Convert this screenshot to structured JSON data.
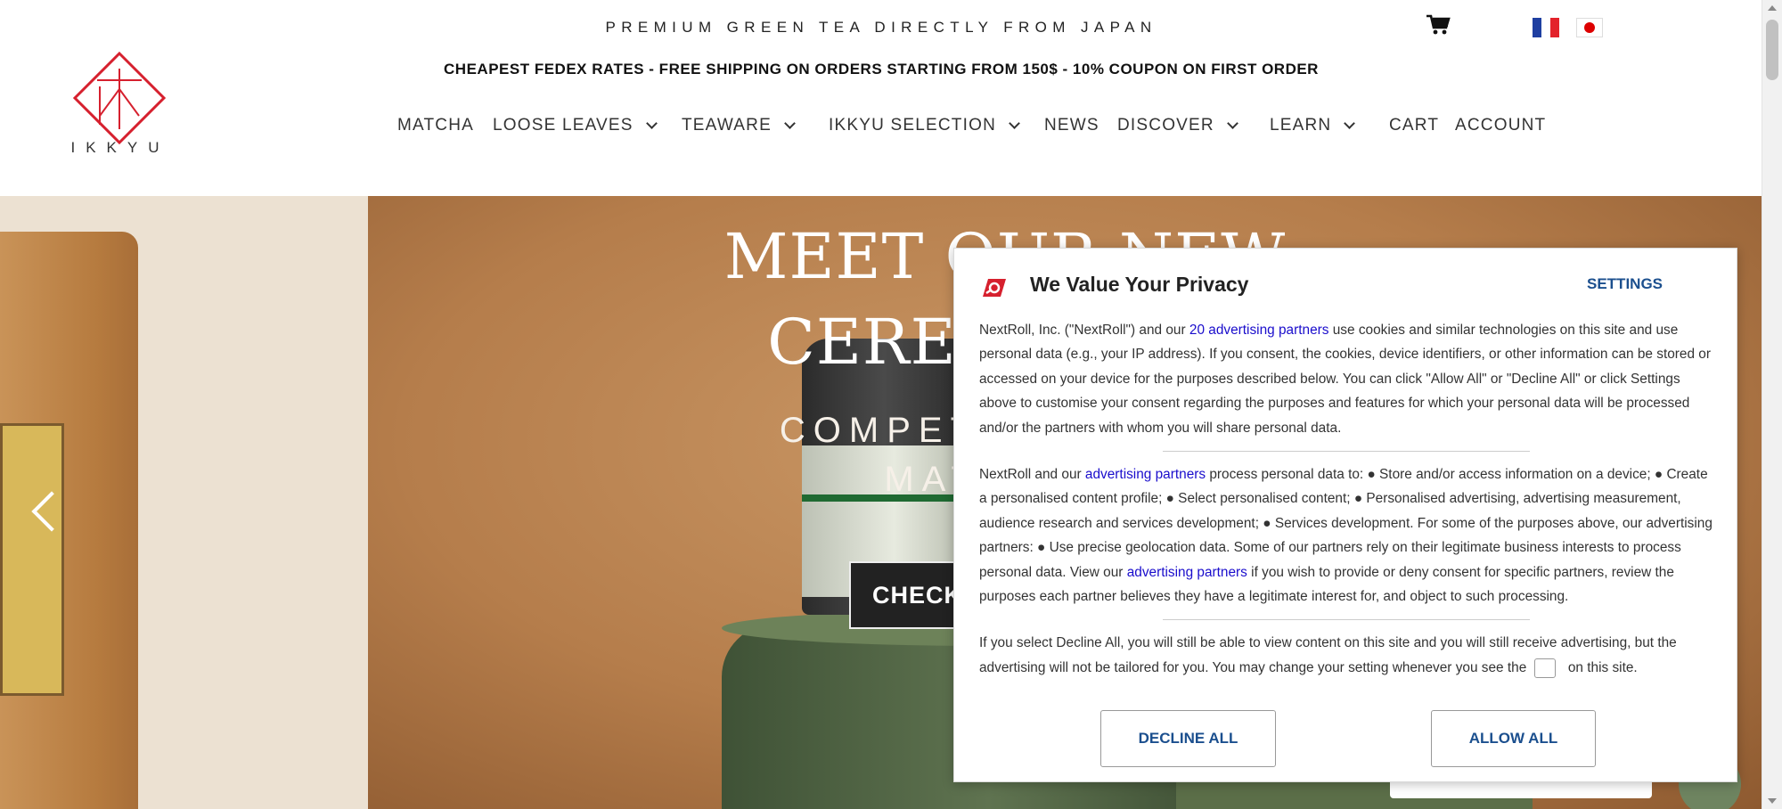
{
  "header": {
    "announcement": "PREMIUM GREEN TEA DIRECTLY FROM JAPAN",
    "promo": "CHEAPEST FEDEX RATES - FREE SHIPPING ON ORDERS STARTING FROM 150$ - 10% COUPON ON FIRST ORDER",
    "logo_text": "IKKYU",
    "cart_icon": "shopping-cart-icon",
    "flags": [
      "france-flag-icon",
      "japan-flag-icon"
    ]
  },
  "nav": {
    "items": [
      {
        "label": "MATCHA",
        "dropdown": false
      },
      {
        "label": "LOOSE LEAVES",
        "dropdown": true
      },
      {
        "label": "TEAWARE",
        "dropdown": true
      },
      {
        "label": "IKKYU SELECTION",
        "dropdown": true
      },
      {
        "label": "NEWS",
        "dropdown": false
      },
      {
        "label": "DISCOVER",
        "dropdown": true
      },
      {
        "label": "LEARN",
        "dropdown": true
      },
      {
        "label": "CART",
        "dropdown": false
      },
      {
        "label": "ACCOUNT",
        "dropdown": false
      }
    ]
  },
  "hero": {
    "title_line1": "MEET OUR NEW",
    "title_line2": "CEREMONIAL",
    "subtitle_line1": "COMPETITION AND",
    "subtitle_line2": "MATCHA F",
    "cta": "CHECK",
    "prev_icon": "chevron-left-icon"
  },
  "consent": {
    "title": "We Value Your Privacy",
    "settings_label": "SETTINGS",
    "p1_a": "NextRoll, Inc. (\"NextRoll\") and our ",
    "p1_link": "20 advertising partners",
    "p1_b": " use cookies and similar technologies on this site and use personal data (e.g., your IP address). If you consent, the cookies, device identifiers, or other information can be stored or accessed on your device for the purposes described below. You can click \"Allow All\" or \"Decline All\" or click Settings above to customise your consent regarding the purposes and features for which your personal data will be processed and/or the partners with whom you will share personal data.",
    "p2_a": "NextRoll and our ",
    "p2_link1": "advertising partners",
    "p2_b": " process personal data to: ● Store and/or access information on a device; ● Create a personalised content profile; ● Select personalised content; ● Personalised advertising, advertising measurement, audience research and services development; ● Services development. For some of the purposes above, our advertising partners: ● Use precise geolocation data. Some of our partners rely on their legitimate business interests to process personal data. View our ",
    "p2_link2": "advertising partners",
    "p2_c": " if you wish to provide or deny consent for specific partners, review the purposes each partner believes they have a legitimate interest for, and object to such processing.",
    "p3_a": "If you select Decline All, you will still be able to view content on this site and you will still receive advertising, but the advertising will not be tailored for you. You may change your setting whenever you see the ",
    "p3_b": " on this site.",
    "decline_label": "DECLINE ALL",
    "allow_label": "ALLOW ALL"
  },
  "colors": {
    "brand_red": "#d6202e",
    "consent_button_text": "#1b4f8e",
    "link": "#1a0dcc"
  }
}
